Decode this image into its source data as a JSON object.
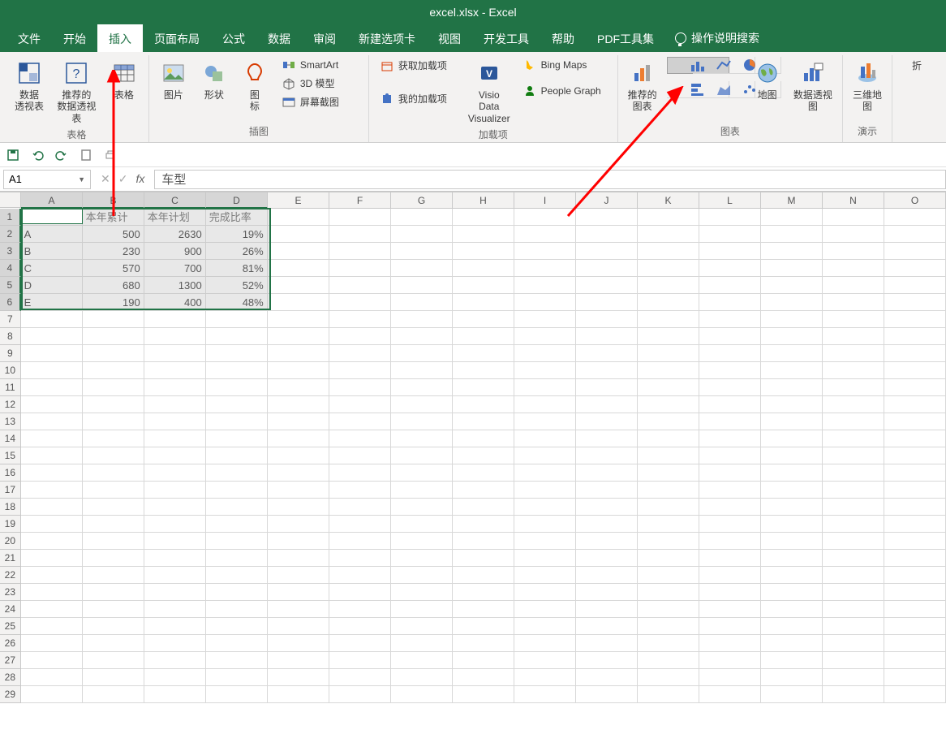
{
  "title": "excel.xlsx - Excel",
  "tabs": {
    "file": "文件",
    "home": "开始",
    "insert": "插入",
    "pagelayout": "页面布局",
    "formulas": "公式",
    "data": "数据",
    "review": "审阅",
    "newtab": "新建选项卡",
    "view": "视图",
    "developer": "开发工具",
    "help": "帮助",
    "pdf": "PDF工具集",
    "tellme": "操作说明搜索"
  },
  "ribbon": {
    "tables": {
      "pivot": "数据\n透视表",
      "recpivot": "推荐的\n数据透视表",
      "table": "表格",
      "label": "表格"
    },
    "illustrations": {
      "picture": "图片",
      "shapes": "形状",
      "icons": "图\n标",
      "smartart": "SmartArt",
      "model3d": "3D 模型",
      "screenshot": "屏幕截图",
      "label": "插图"
    },
    "addins": {
      "get": "获取加载项",
      "my": "我的加载项",
      "visio": "Visio Data\nVisualizer",
      "bing": "Bing Maps",
      "people": "People Graph",
      "label": "加载项"
    },
    "charts": {
      "recommended": "推荐的\n图表",
      "maps": "地图",
      "pivotchart": "数据透视图",
      "label": "图表"
    },
    "tours": {
      "map3d": "三维地\n图",
      "label": "演示"
    },
    "spark": "折"
  },
  "namebox": "A1",
  "formula": "车型",
  "columns": [
    "A",
    "B",
    "C",
    "D",
    "E",
    "F",
    "G",
    "H",
    "I",
    "J",
    "K",
    "L",
    "M",
    "N",
    "O"
  ],
  "chart_data": {
    "type": "table",
    "headers": [
      "车型",
      "本年累计",
      "本年计划",
      "完成比率"
    ],
    "rows": [
      {
        "model": "A",
        "cumulative": 500,
        "plan": 2630,
        "rate": "19%"
      },
      {
        "model": "B",
        "cumulative": 230,
        "plan": 900,
        "rate": "26%"
      },
      {
        "model": "C",
        "cumulative": 570,
        "plan": 700,
        "rate": "81%"
      },
      {
        "model": "D",
        "cumulative": 680,
        "plan": 1300,
        "rate": "52%"
      },
      {
        "model": "E",
        "cumulative": 190,
        "plan": 400,
        "rate": "48%"
      }
    ]
  },
  "visible_rows": 29
}
